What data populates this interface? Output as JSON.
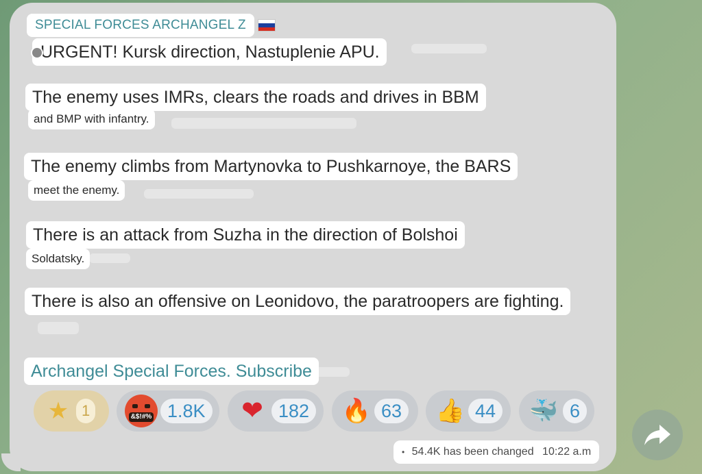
{
  "channel": {
    "name": "SPECIAL FORCES ARCHANGEL Z",
    "flag_icon": "russia-flag-icon",
    "flag_colors": [
      "#ffffff",
      "#1c3f9e",
      "#d52b1e"
    ]
  },
  "message": {
    "headline": "URGENT! Kursk direction, Nastuplenie APU.",
    "paragraphs": [
      {
        "line1": "The enemy uses IMRs, clears the roads and drives in BBM",
        "line2": "and BMP with infantry."
      },
      {
        "line1": "The enemy climbs from Martynovka to Pushkarnoye, the BARS",
        "line2": "meet the enemy."
      },
      {
        "line1": "There is an attack from Suzha in the direction of Bolshoi",
        "line2": "Soldatsky."
      },
      {
        "line1": "There is also an offensive on Leonidovo, the paratroopers are fighting.",
        "line2": ""
      }
    ],
    "subscribe_link": "Archangel Special Forces. Subscribe"
  },
  "reactions": [
    {
      "icon": "star-icon",
      "count": "1",
      "active": true
    },
    {
      "icon": "angry-cursing-face-icon",
      "count": "1.8K",
      "active": false
    },
    {
      "icon": "heart-icon",
      "count": "182",
      "active": false
    },
    {
      "icon": "fire-icon",
      "count": "63",
      "active": false
    },
    {
      "icon": "thumbs-up-icon",
      "count": "44",
      "active": false
    },
    {
      "icon": "whale-icon",
      "count": "6",
      "active": false
    }
  ],
  "footer": {
    "views": "54.4K has been changed",
    "time": "10:22 a.m"
  },
  "colors": {
    "accent": "#3f8c96",
    "count_blue": "#3a8ec4",
    "bubble": "#d9d9d9",
    "background": "#8fb08a"
  }
}
